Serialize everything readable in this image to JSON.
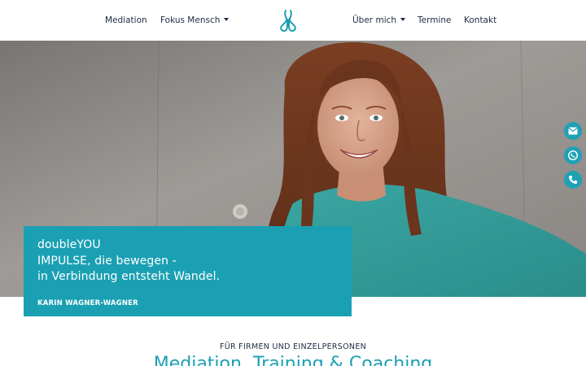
{
  "nav": {
    "left": [
      "Mediation",
      "Fokus Mensch"
    ],
    "right": [
      "Über mich",
      "Termine",
      "Kontakt"
    ]
  },
  "hero": {
    "lines": [
      "doubleYOU",
      "IMPULSE, die bewegen -",
      "in Verbindung entsteht Wandel."
    ],
    "author": "KARIN WAGNER-WAGNER"
  },
  "section": {
    "eyebrow": "FÜR FIRMEN UND EINZELPERSONEN",
    "title": "Mediation, Training & Coaching"
  },
  "side_buttons": [
    "envelope-icon",
    "whatsapp-icon",
    "phone-icon"
  ],
  "colors": {
    "accent": "#1ba0b3",
    "nav_text": "#1f2a44"
  }
}
